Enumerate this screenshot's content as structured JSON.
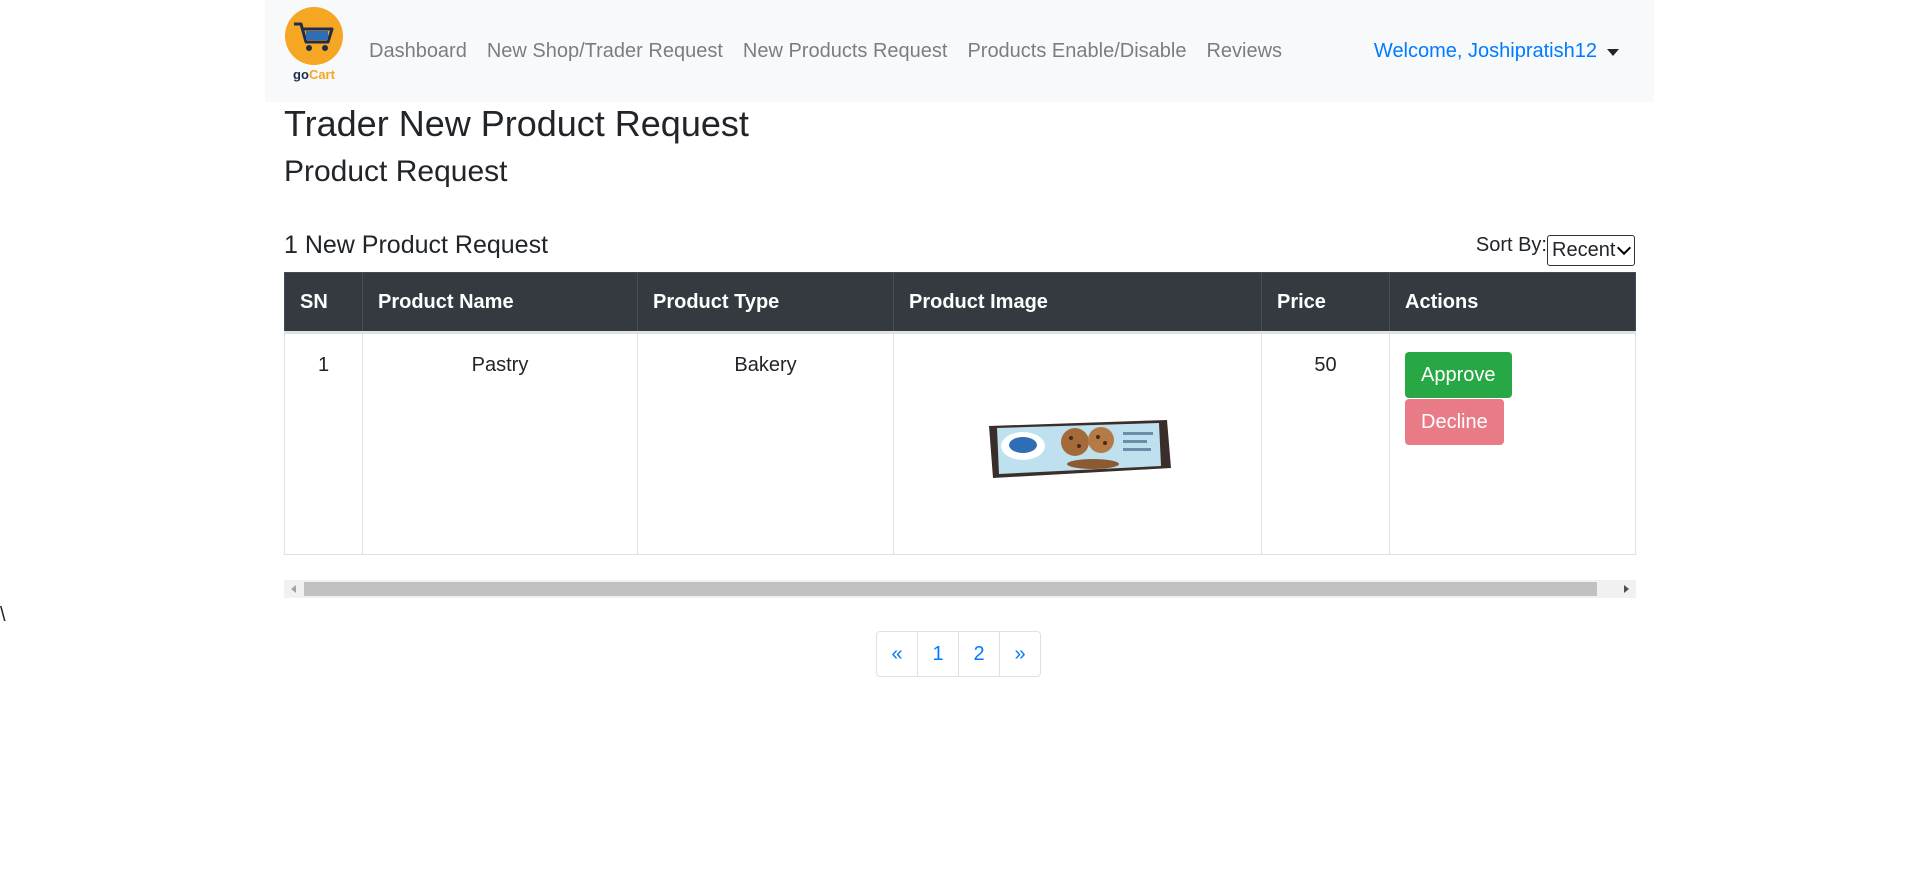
{
  "navbar": {
    "logo_text_main": "go",
    "logo_text_accent": "Cart",
    "links": [
      {
        "label": "Dashboard"
      },
      {
        "label": "New Shop/Trader Request"
      },
      {
        "label": "New Products Request"
      },
      {
        "label": "Products Enable/Disable"
      },
      {
        "label": "Reviews"
      }
    ],
    "user_menu": "Welcome, Joshipratish12"
  },
  "stray_char": "\\",
  "page": {
    "title": "Trader New Product Request",
    "subtitle": "Product Request",
    "count_heading": "1 New Product Request",
    "sort_label": "Sort By:",
    "sort_selected": "Recent"
  },
  "table": {
    "headers": [
      "SN",
      "Product Name",
      "Product Type",
      "Product Image",
      "Price",
      "Actions"
    ],
    "rows": [
      {
        "sn": "1",
        "name": "Pastry",
        "type": "Bakery",
        "image": "cookie-pack-image",
        "price": "50",
        "approve_label": "Approve",
        "decline_label": "Decline"
      }
    ]
  },
  "pagination": {
    "prev": "«",
    "pages": [
      "1",
      "2"
    ],
    "next": "»"
  },
  "colors": {
    "approve": "#28a745",
    "decline": "#e97b86",
    "table_header": "#343a40",
    "link": "#007bff"
  }
}
